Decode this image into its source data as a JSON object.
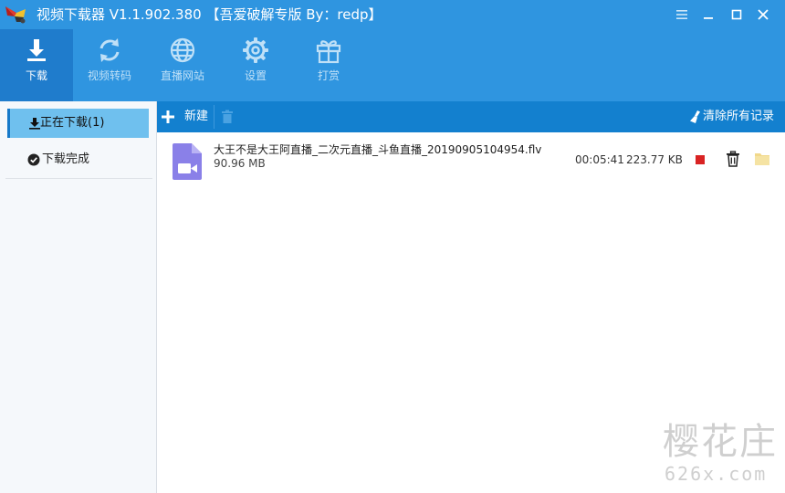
{
  "window": {
    "title": "视频下载器 V1.1.902.380 【吾爱破解专版 By：redp】",
    "logo_icon": "app-logo-icon",
    "controls": [
      "menu-icon",
      "minimize-icon",
      "maximize-icon",
      "close-icon"
    ]
  },
  "toolbar": {
    "items": [
      {
        "label": "下载",
        "icon": "download-icon",
        "active": true
      },
      {
        "label": "视频转码",
        "icon": "convert-icon",
        "active": false
      },
      {
        "label": "直播网站",
        "icon": "globe-icon",
        "active": false
      },
      {
        "label": "设置",
        "icon": "gear-icon",
        "active": false
      },
      {
        "label": "打赏",
        "icon": "gift-icon",
        "active": false
      }
    ]
  },
  "sidebar": {
    "items": [
      {
        "label": "正在下载(1)",
        "icon": "download-small-icon",
        "active": true
      },
      {
        "label": "下载完成",
        "icon": "check-circle-icon",
        "active": false
      }
    ]
  },
  "actions": {
    "new_label": "新建",
    "new_icon": "plus-icon",
    "delete_icon": "trash-icon",
    "clear_label": "清除所有记录",
    "clear_icon": "broom-icon"
  },
  "tasks": [
    {
      "file_name": "大王不是大王阿直播_二次元直播_斗鱼直播_20190905104954.flv",
      "file_size": "90.96 MB",
      "elapsed": "00:05:41",
      "speed": "223.77 KB",
      "icon": "video-file-icon"
    }
  ],
  "watermark": {
    "line1": "樱花庄",
    "line2": "626x.com"
  },
  "colors": {
    "header_blue": "#2f95e0",
    "active_tool_blue": "#1f7ccc",
    "actionbar_blue": "#1380cf",
    "sidebar_active": "#6fc0ee",
    "stop_red": "#d92323",
    "folder_yellow": "#f1d88a",
    "file_icon_purple": "#8a80e8"
  }
}
